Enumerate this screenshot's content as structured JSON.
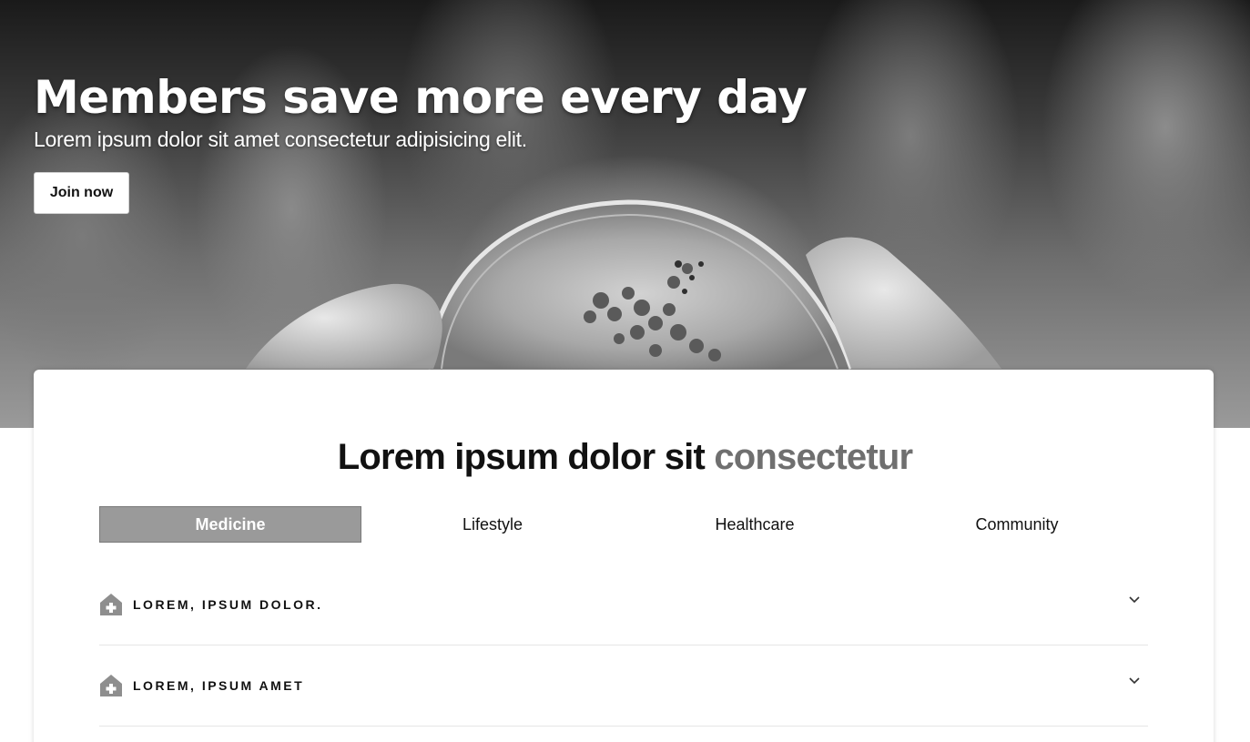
{
  "hero": {
    "title": "Members save more every day",
    "subtitle": "Lorem ipsum dolor sit amet consectetur adipisicing elit.",
    "cta_label": "Join now"
  },
  "section": {
    "title_main": "Lorem ipsum dolor sit",
    "title_accent": "consectetur"
  },
  "tabs": [
    {
      "label": "Medicine",
      "active": true
    },
    {
      "label": "Lifestyle",
      "active": false
    },
    {
      "label": "Healthcare",
      "active": false
    },
    {
      "label": "Community",
      "active": false
    }
  ],
  "accordion": [
    {
      "label": "LOREM, IPSUM DOLOR.",
      "icon": "medical-house-icon",
      "expanded": false
    },
    {
      "label": "LOREM, IPSUM AMET",
      "icon": "medical-house-icon",
      "expanded": false
    }
  ],
  "colors": {
    "tab_active_bg": "#9a9a9a",
    "title_accent": "#6f6f6f"
  }
}
